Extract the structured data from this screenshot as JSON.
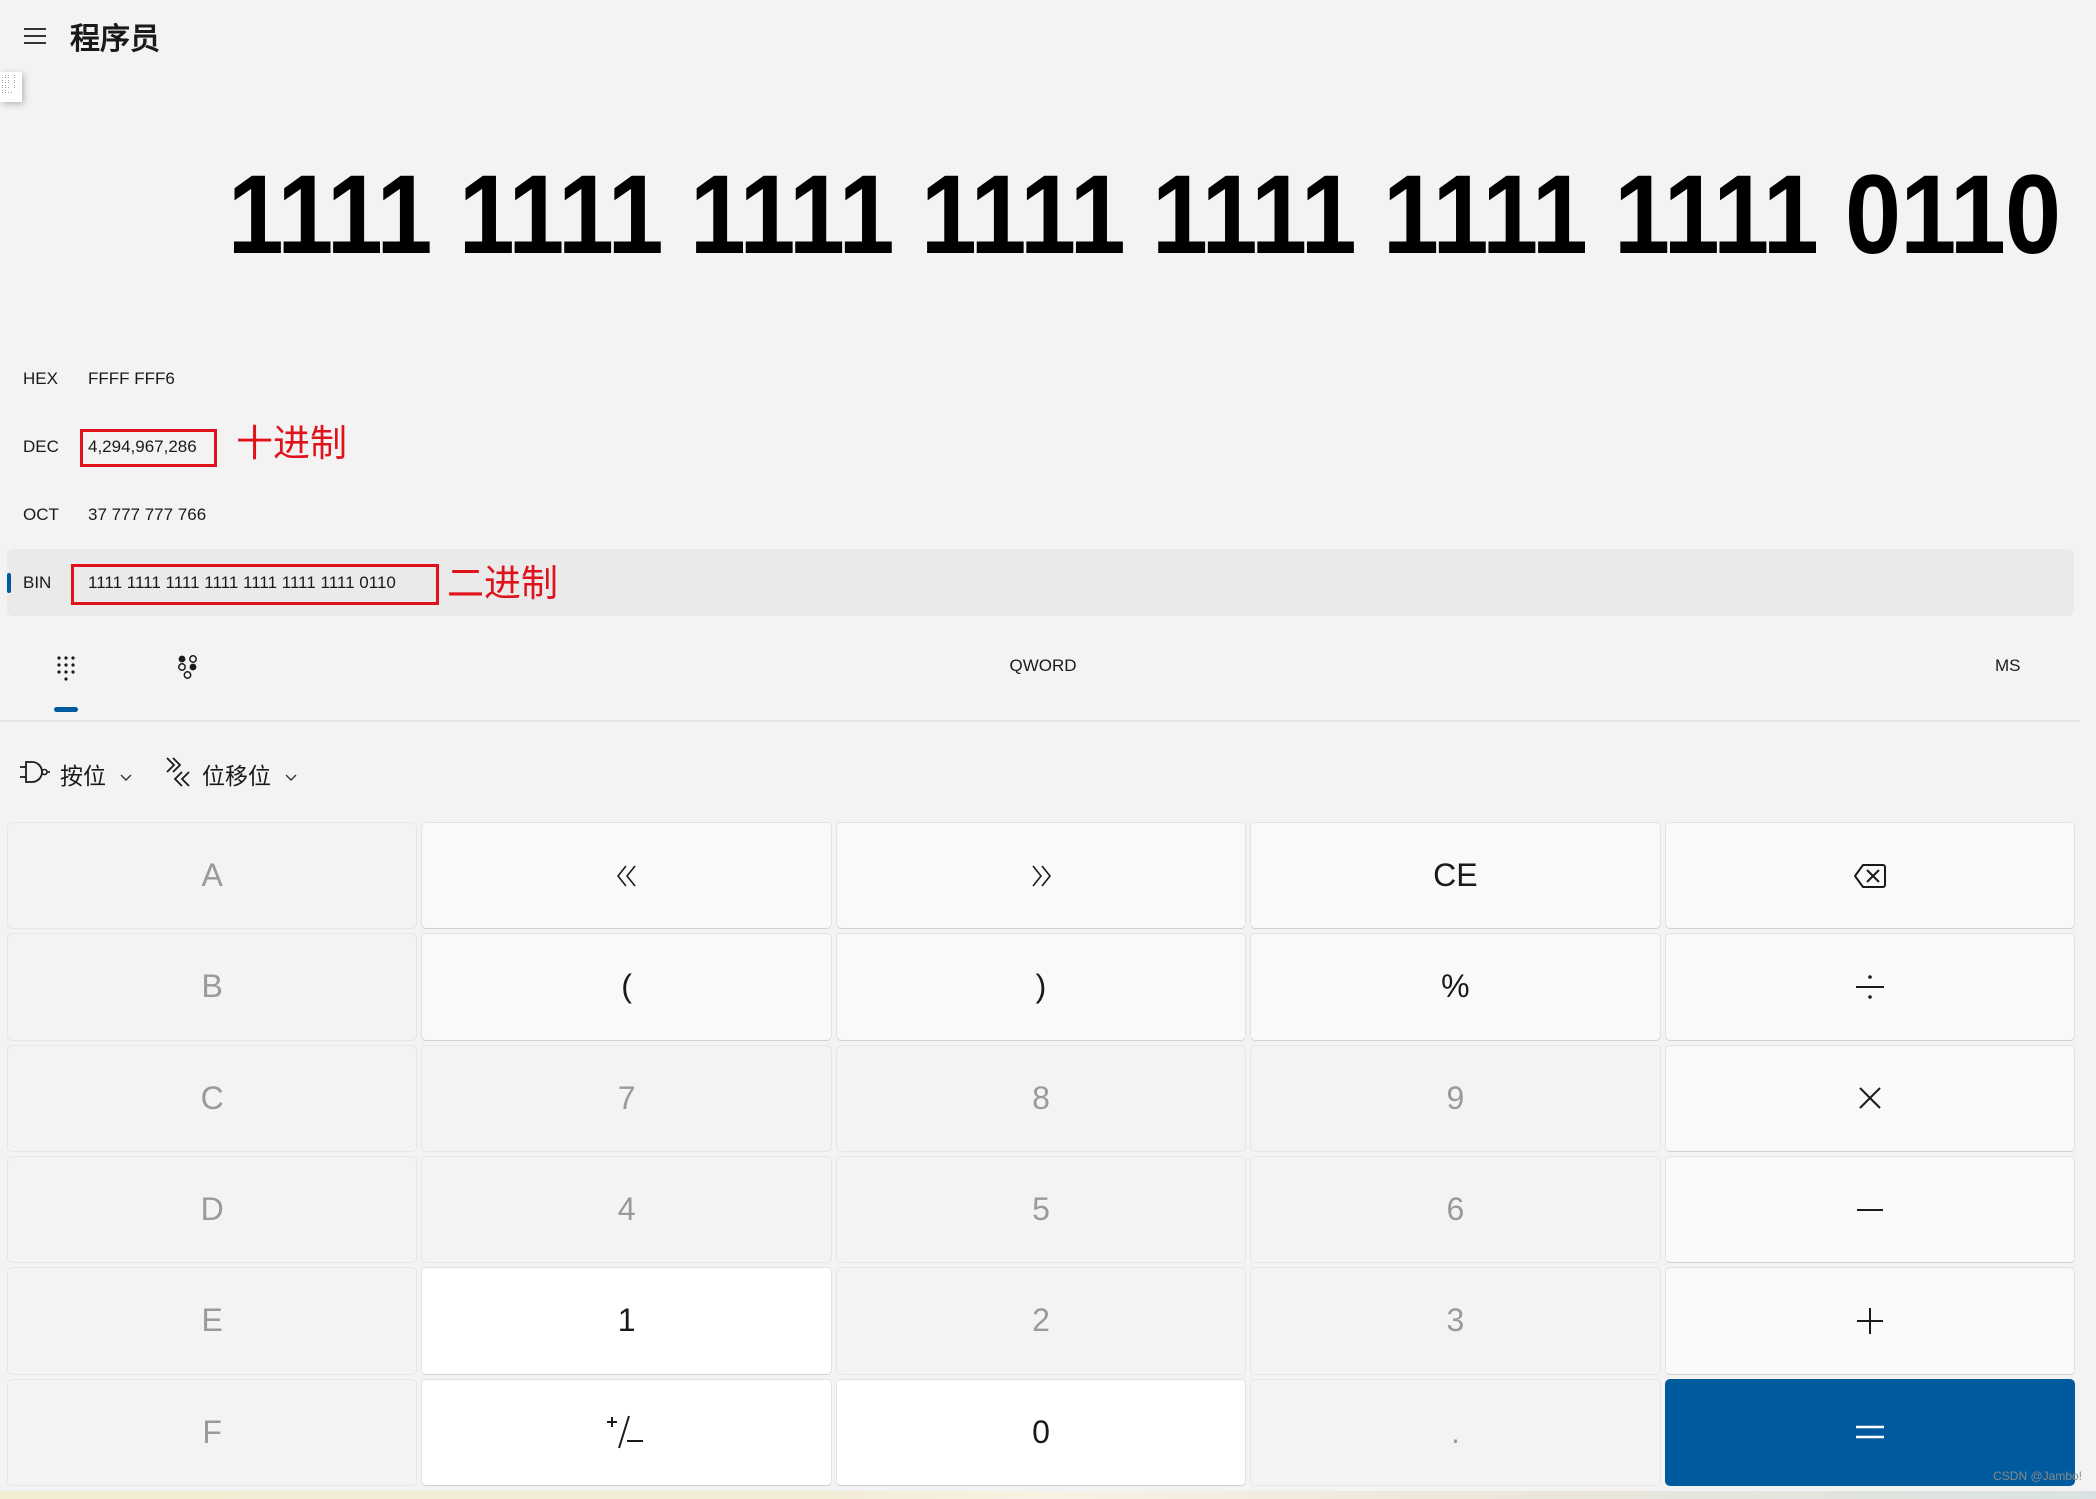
{
  "header": {
    "menu_icon": "hamburger-menu-icon",
    "title": "程序员"
  },
  "memory_thumbnail": ".:: :\n:.: :\n::. :\n::..",
  "display": {
    "value": "1111 1111 1111 1111 1111 1111 1111 0110"
  },
  "radix": [
    {
      "label": "HEX",
      "value": "FFFF FFF6",
      "active": false
    },
    {
      "label": "DEC",
      "value": "4,294,967,286",
      "active": false
    },
    {
      "label": "OCT",
      "value": "37 777 777 766",
      "active": false
    },
    {
      "label": "BIN",
      "value": "1111 1111 1111 1111 1111 1111 1111 0110",
      "active": true
    }
  ],
  "annotations": {
    "dec": "十进制",
    "bin": "二进制",
    "color": "#e0131c"
  },
  "tabs": {
    "keypad_icon": "full-keypad-icon",
    "bitflip_icon": "bit-toggling-keypad-icon",
    "word_size": "QWORD",
    "memory_store": "MS"
  },
  "bitwise": {
    "bitwise_label": "按位",
    "shift_label": "位移位"
  },
  "keypad": {
    "rows": [
      [
        "A",
        "«",
        "»",
        "CE",
        "backspace"
      ],
      [
        "B",
        "(",
        ")",
        "%",
        "÷"
      ],
      [
        "C",
        "7",
        "8",
        "9",
        "×"
      ],
      [
        "D",
        "4",
        "5",
        "6",
        "−"
      ],
      [
        "E",
        "1",
        "2",
        "3",
        "+"
      ],
      [
        "F",
        "+/−",
        "0",
        ".",
        "="
      ]
    ]
  },
  "colors": {
    "accent": "#005a9e",
    "background": "#f3f3f3",
    "disabled_text": "#9a9a9a"
  },
  "watermark": "CSDN @Jambo!"
}
